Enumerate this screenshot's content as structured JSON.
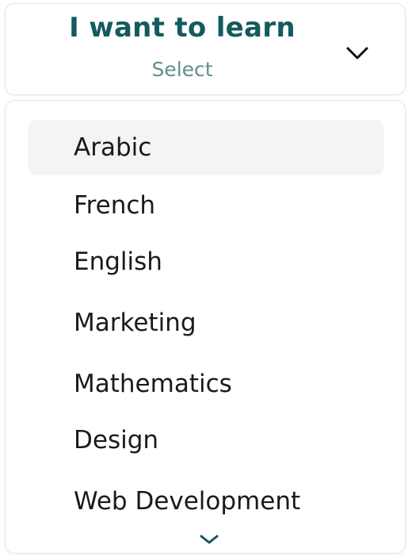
{
  "header": {
    "title": "I want to learn",
    "placeholder": "Select"
  },
  "options": [
    "Arabic",
    "French",
    "English",
    "Marketing",
    "Mathematics",
    "Design",
    "Web Development"
  ],
  "selected_index": 0,
  "colors": {
    "title": "#145a5f",
    "placeholder": "#5f8f91",
    "selected_bg": "#f4f4f4",
    "more_chevron": "#145a5f"
  },
  "icons": {
    "header_chevron": "chevron-down-icon",
    "more_chevron": "chevron-down-icon"
  }
}
